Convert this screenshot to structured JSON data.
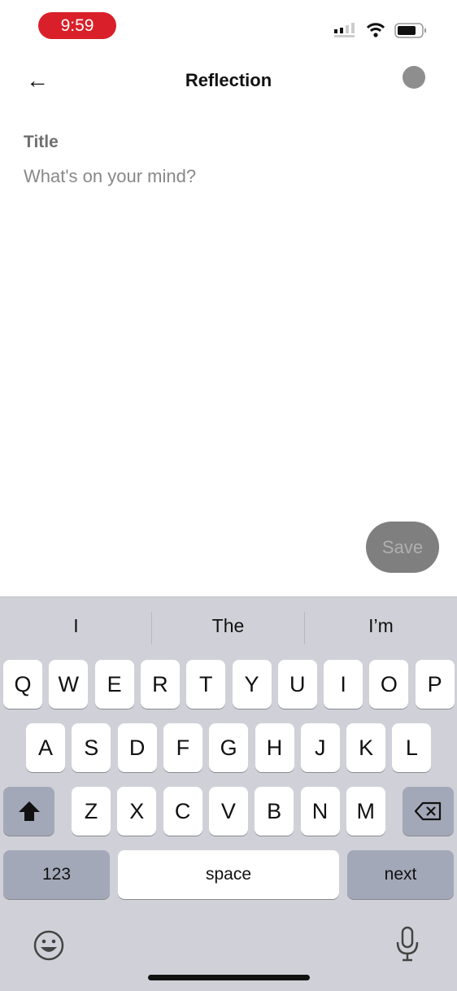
{
  "status_bar": {
    "time": "9:59",
    "icons": [
      "signal-icon",
      "wifi-icon",
      "battery-icon"
    ]
  },
  "header": {
    "title": "Reflection",
    "back_icon": "arrow-left-icon",
    "avatar_color": "#8e8e8e"
  },
  "form": {
    "label": "Title",
    "placeholder": "What's on your mind?",
    "value": ""
  },
  "save_label": "Save",
  "keyboard": {
    "suggestions": [
      "I",
      "The",
      "I’m"
    ],
    "row1": [
      "Q",
      "W",
      "E",
      "R",
      "T",
      "Y",
      "U",
      "I",
      "O",
      "P"
    ],
    "row2": [
      "A",
      "S",
      "D",
      "F",
      "G",
      "H",
      "J",
      "K",
      "L"
    ],
    "row3": [
      "Z",
      "X",
      "C",
      "V",
      "B",
      "N",
      "M"
    ],
    "numbers_label": "123",
    "space_label": "space",
    "next_label": "next"
  }
}
